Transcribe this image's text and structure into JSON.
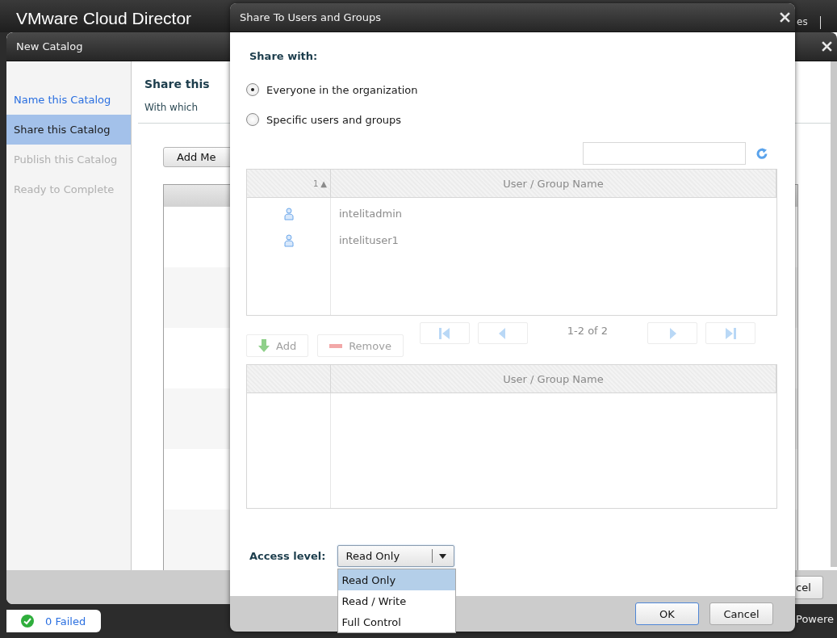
{
  "app": {
    "title": "VMware Cloud Director",
    "header_text": "es"
  },
  "wizard": {
    "title": "New Catalog",
    "steps": [
      {
        "label": "Name this Catalog",
        "selected": false,
        "disabled": false
      },
      {
        "label": "Share this Catalog",
        "selected": true,
        "disabled": false
      },
      {
        "label": "Publish this Catalog",
        "selected": false,
        "disabled": true
      },
      {
        "label": "Ready to Complete",
        "selected": false,
        "disabled": true
      }
    ],
    "heading": "Share this",
    "description": "With which",
    "add_button": "Add Me",
    "footer_button": "cel"
  },
  "dialog": {
    "title": "Share To Users and Groups",
    "share_with": {
      "label": "Share with:",
      "options": [
        {
          "label": "Everyone in the organization",
          "selected": true
        },
        {
          "label": "Specific users and groups",
          "selected": false
        }
      ]
    },
    "available_table": {
      "columns": [
        {
          "label": "1",
          "sort_mark": "▲"
        },
        {
          "label": "User / Group Name"
        }
      ],
      "rows": [
        {
          "kind": "user",
          "name": "intelitadmin"
        },
        {
          "kind": "user",
          "name": "intelituser1"
        }
      ]
    },
    "add_button": {
      "label": "Add",
      "disabled": true
    },
    "remove_button": {
      "label": "Remove",
      "disabled": true
    },
    "pagination": {
      "range": "1-2 of 2"
    },
    "selected_table": {
      "column": "User / Group Name"
    },
    "access_level": {
      "label": "Access level:",
      "value": "Read Only",
      "expanded": true,
      "options": [
        {
          "label": "Read Only",
          "selected": true
        },
        {
          "label": "Read / Write",
          "selected": false
        },
        {
          "label": "Full Control",
          "selected": false
        }
      ]
    },
    "buttons": [
      {
        "label": "OK",
        "default": true
      },
      {
        "label": "Cancel",
        "default": false
      }
    ]
  },
  "status": {
    "failed": "0 Failed",
    "footer_text": "Powere"
  }
}
